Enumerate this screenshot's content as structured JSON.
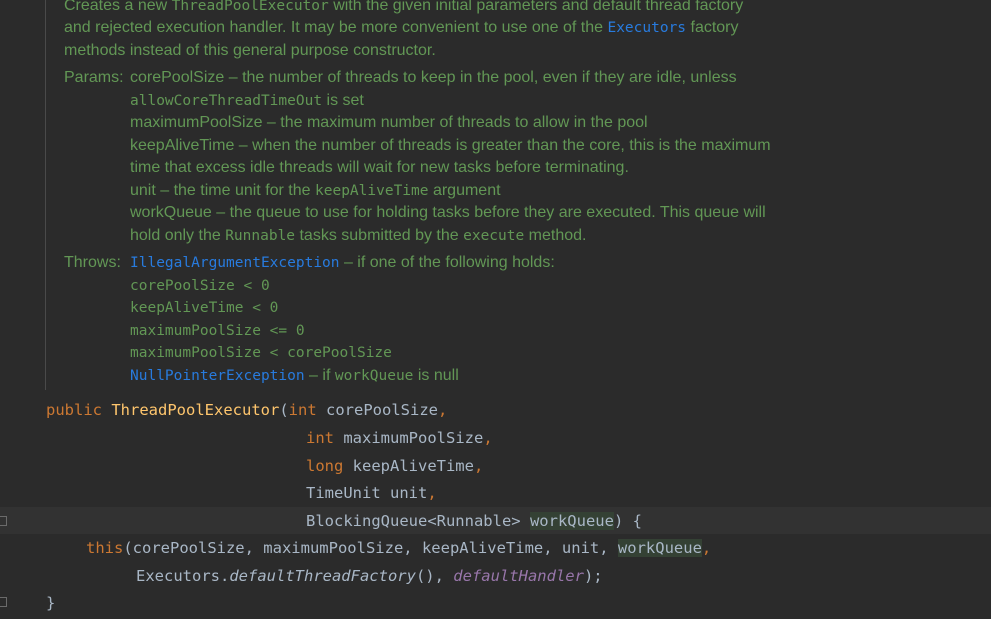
{
  "doc": {
    "desc_1a": "Creates a new ",
    "desc_1b": "ThreadPoolExecutor",
    "desc_1c": " with the given initial parameters and default thread factory",
    "desc_2a": "and rejected execution handler. It may be more convenient to use one of the ",
    "desc_2b": "Executors",
    "desc_2c": " factory",
    "desc_3": "methods instead of this general purpose constructor.",
    "params_label": "Params:",
    "p1a": "corePoolSize – the number of threads to keep in the pool, even if they are idle, unless",
    "p1b": "allowCoreThreadTimeOut",
    "p1c": " is set",
    "p2": "maximumPoolSize – the maximum number of threads to allow in the pool",
    "p3a": "keepAliveTime – when the number of threads is greater than the core, this is the maximum",
    "p3b": "time that excess idle threads will wait for new tasks before terminating.",
    "p4a": "unit – the time unit for the ",
    "p4b": "keepAliveTime",
    "p4c": " argument",
    "p5a": "workQueue – the queue to use for holding tasks before they are executed. This queue will",
    "p5b": "hold only the ",
    "p5c": "Runnable",
    "p5d": " tasks submitted by the ",
    "p5e": "execute",
    "p5f": " method.",
    "throws_label": "Throws:",
    "t1a": "IllegalArgumentException",
    "t1b": " – if one of the following holds:",
    "t2": "corePoolSize < 0",
    "t3": "keepAliveTime < 0",
    "t4": "maximumPoolSize <= 0",
    "t5": "maximumPoolSize < corePoolSize",
    "t6a": "NullPointerException",
    "t6b": " – if ",
    "t6c": "workQueue",
    "t6d": " is null"
  },
  "code": {
    "l1_kw": "public",
    "l1_fn": "ThreadPoolExecutor",
    "l1_p": "(",
    "l1_type": "int",
    "l1_param": " corePoolSize",
    "l1_comma": ",",
    "l2_type": "int",
    "l2_param": " maximumPoolSize",
    "l2_comma": ",",
    "l3_type": "long",
    "l3_param": " keepAliveTime",
    "l3_comma": ",",
    "l4_param": "TimeUnit unit",
    "l4_comma": ",",
    "l5_param": "BlockingQueue<Runnable> ",
    "l5_hl": "workQueue",
    "l5_end": ") {",
    "l6_kw": "this",
    "l6_args": "(corePoolSize, maximumPoolSize, keepAliveTime, unit, ",
    "l6_hl": "workQueue",
    "l6_comma": ",",
    "l7_a": "Executors.",
    "l7_b": "defaultThreadFactory",
    "l7_c": "(), ",
    "l7_d": "defaultHandler",
    "l7_e": ");",
    "l8": "}"
  },
  "colors": {
    "background": "#2b2b2b",
    "doc_text": "#629755",
    "link": "#287bde",
    "keyword": "#cc7832",
    "method": "#ffc66d",
    "field": "#9876aa",
    "text": "#a9b7c6"
  }
}
